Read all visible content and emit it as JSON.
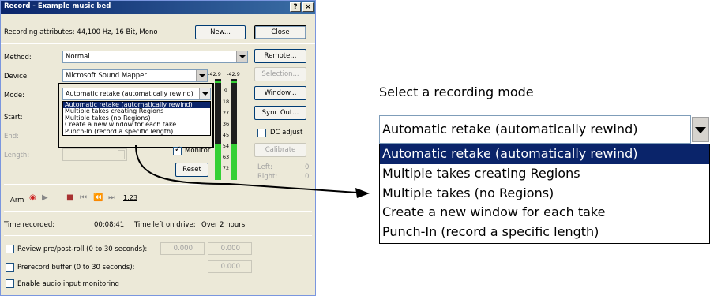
{
  "window": {
    "title": "Record - Example music bed"
  },
  "title_buttons": {
    "help": "?",
    "close": "×"
  },
  "recording_attributes": "Recording attributes:  44,100 Hz, 16 Bit, Mono",
  "buttons": {
    "new": "New...",
    "close": "Close",
    "remote": "Remote...",
    "selection": "Selection...",
    "window": "Window...",
    "sync_out": "Sync Out...",
    "calibrate": "Calibrate",
    "reset": "Reset"
  },
  "labels": {
    "method": "Method:",
    "device": "Device:",
    "mode": "Mode:",
    "start": "Start:",
    "end": "End:",
    "length": "Length:",
    "monitor": "Monitor",
    "dc_adjust": "DC adjust",
    "left": "Left:",
    "right": "Right:",
    "left_value": "0",
    "right_value": "0",
    "arm": "Arm"
  },
  "method": {
    "value": "Normal"
  },
  "device": {
    "value": "Microsoft Sound Mapper"
  },
  "mode": {
    "value": "Automatic retake (automatically rewind)",
    "options": [
      "Automatic retake (automatically rewind)",
      "Multiple takes creating Regions",
      "Multiple takes (no Regions)",
      "Create a new window for each take",
      "Punch-In (record a specific length)"
    ],
    "selected_index": 0
  },
  "meters": {
    "peak_left": "-42.9",
    "peak_right": "-42.9",
    "scale": [
      "9",
      "18",
      "27",
      "36",
      "45",
      "54",
      "63",
      "72"
    ]
  },
  "transport": {
    "counter": "1:23"
  },
  "status": {
    "time_recorded_label": "Time recorded:",
    "time_recorded": "00:08:41",
    "time_left_label": "Time left on drive:",
    "time_left": "Over 2 hours."
  },
  "options": {
    "review_label": "Review pre/post-roll (0 to 30 seconds):",
    "review_pre": "0.000",
    "review_post": "0.000",
    "prerecord_label": "Prerecord buffer (0 to 30 seconds):",
    "prerecord_value": "0.000",
    "monitoring_label": "Enable audio input monitoring"
  },
  "callout": {
    "label": "Select a recording mode"
  },
  "colors": {
    "selection": "#0a246a",
    "meter": "#35d035",
    "titlebar": "#0a246a"
  }
}
